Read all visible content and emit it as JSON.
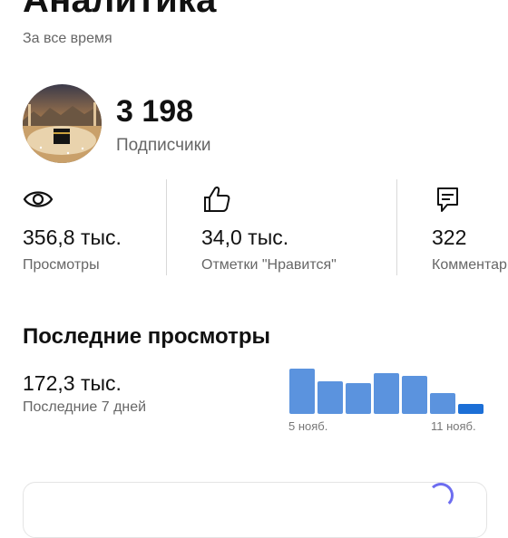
{
  "header": {
    "title": "Аналитика",
    "period": "За все время"
  },
  "profile": {
    "subscribers_count": "3 198",
    "subscribers_label": "Подписчики"
  },
  "stats": [
    {
      "icon": "eye-icon",
      "value": "356,8 тыс.",
      "label": "Просмотры"
    },
    {
      "icon": "thumbs-up-icon",
      "value": "34,0 тыс.",
      "label": "Отметки \"Нравится\""
    },
    {
      "icon": "comment-icon",
      "value": "322",
      "label": "Комментарии"
    }
  ],
  "recent": {
    "title": "Последние просмотры",
    "value": "172,3 тыс.",
    "label": "Последние 7 дней"
  },
  "chart_data": {
    "type": "bar",
    "x_start_label": "5 нояб.",
    "x_end_label": "11 нояб.",
    "values": [
      50,
      36,
      34,
      45,
      42,
      23,
      11
    ],
    "ylim": [
      0,
      50
    ],
    "bar_color": "#5b93de",
    "highlight_color": "#1c6fd6",
    "highlight_index": 6
  }
}
